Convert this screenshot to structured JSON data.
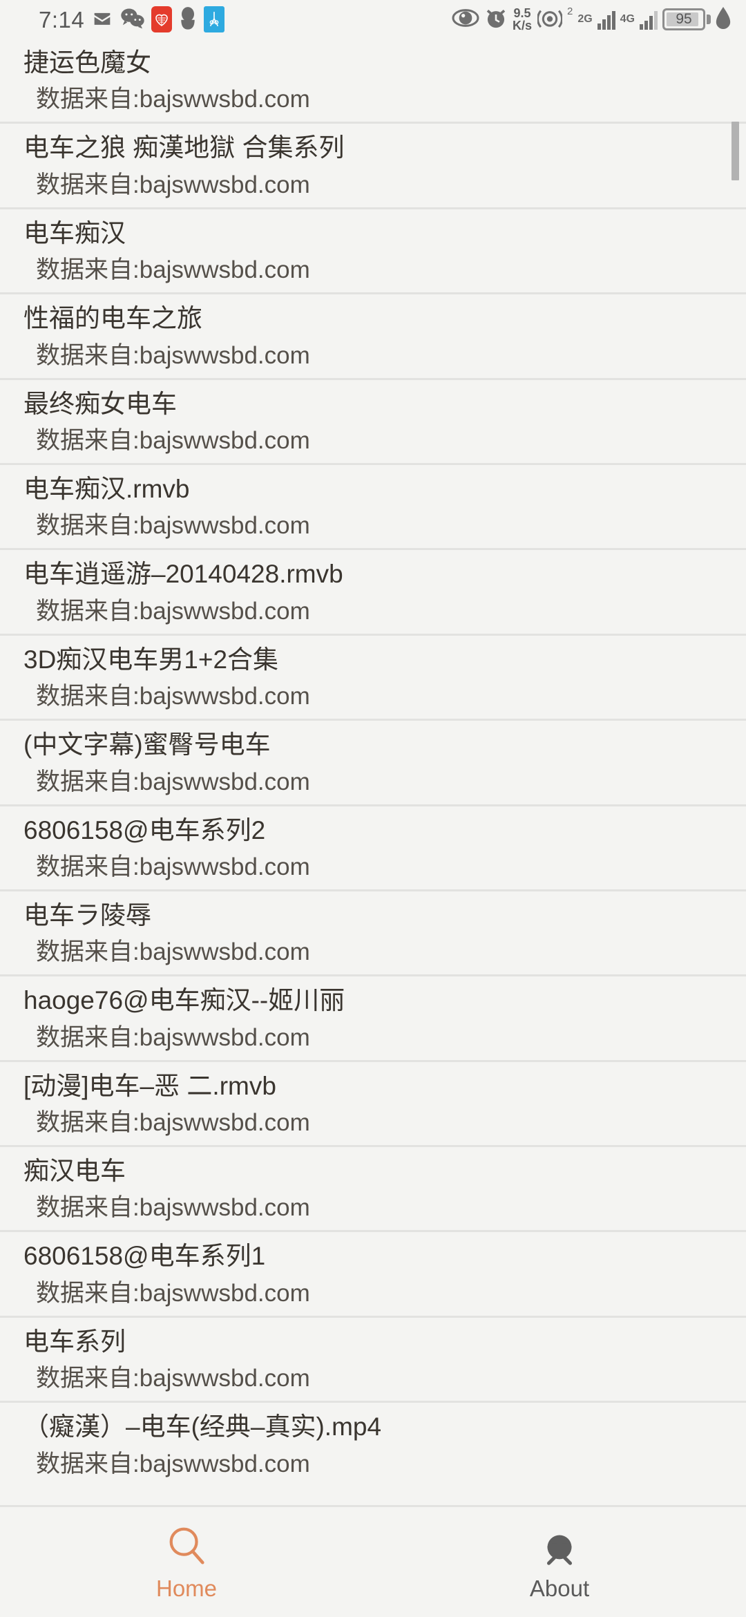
{
  "status_bar": {
    "time": "7:14",
    "notification_icons": [
      "mail-icon",
      "wechat-icon",
      "xiaohongshu-icon",
      "qq-penguin-icon",
      "app-blue-icon"
    ],
    "network_speed": "9.5",
    "network_speed_unit": "K/s",
    "sim1_label": "2",
    "sim1_net": "2G",
    "sim2_net": "4G",
    "battery_level": "95",
    "right_icons": [
      "eye-care-icon",
      "alarm-icon",
      "network-speed",
      "hotspot-icon",
      "signal-bars-1",
      "signal-bars-2",
      "battery-icon",
      "leaf-icon"
    ]
  },
  "list": {
    "source_prefix": "数据来自:",
    "items": [
      {
        "title": "捷运色魔女",
        "source": "数据来自:bajswwsbd.com"
      },
      {
        "title": "电车之狼 痴漢地獄 合集系列",
        "source": "数据来自:bajswwsbd.com"
      },
      {
        "title": "电车痴汉",
        "source": "数据来自:bajswwsbd.com"
      },
      {
        "title": "性福的电车之旅",
        "source": "数据来自:bajswwsbd.com"
      },
      {
        "title": "最终痴女电车",
        "source": "数据来自:bajswwsbd.com"
      },
      {
        "title": "电车痴汉.rmvb",
        "source": "数据来自:bajswwsbd.com"
      },
      {
        "title": "电车逍遥游–20140428.rmvb",
        "source": "数据来自:bajswwsbd.com"
      },
      {
        "title": "3D痴汉电车男1+2合集",
        "source": "数据来自:bajswwsbd.com"
      },
      {
        "title": "(中文字幕)蜜臀号电车",
        "source": "数据来自:bajswwsbd.com"
      },
      {
        "title": "6806158@电车系列2",
        "source": "数据来自:bajswwsbd.com"
      },
      {
        "title": "电车ラ陵辱",
        "source": "数据来自:bajswwsbd.com"
      },
      {
        "title": "haoge76@电车痴汉--姬川丽",
        "source": "数据来自:bajswwsbd.com"
      },
      {
        "title": "[动漫]电车–恶 二.rmvb",
        "source": "数据来自:bajswwsbd.com"
      },
      {
        "title": "痴汉电车",
        "source": "数据来自:bajswwsbd.com"
      },
      {
        "title": "6806158@电车系列1",
        "source": "数据来自:bajswwsbd.com"
      },
      {
        "title": "电车系列",
        "source": "数据来自:bajswwsbd.com"
      },
      {
        "title": "（癡漢）–电车(经典–真实).mp4",
        "source": "数据来自:bajswwsbd.com"
      }
    ]
  },
  "bottom_nav": {
    "tabs": [
      {
        "label": "Home",
        "icon": "search-icon",
        "active": true
      },
      {
        "label": "About",
        "icon": "bug-icon",
        "active": false
      }
    ]
  },
  "colors": {
    "accent": "#e08a5c",
    "background": "#f4f4f2",
    "title_text": "#3a352f",
    "subtitle_text": "#55504a",
    "divider": "#e2e2e0",
    "inactive_tab": "#5a5a5a"
  }
}
